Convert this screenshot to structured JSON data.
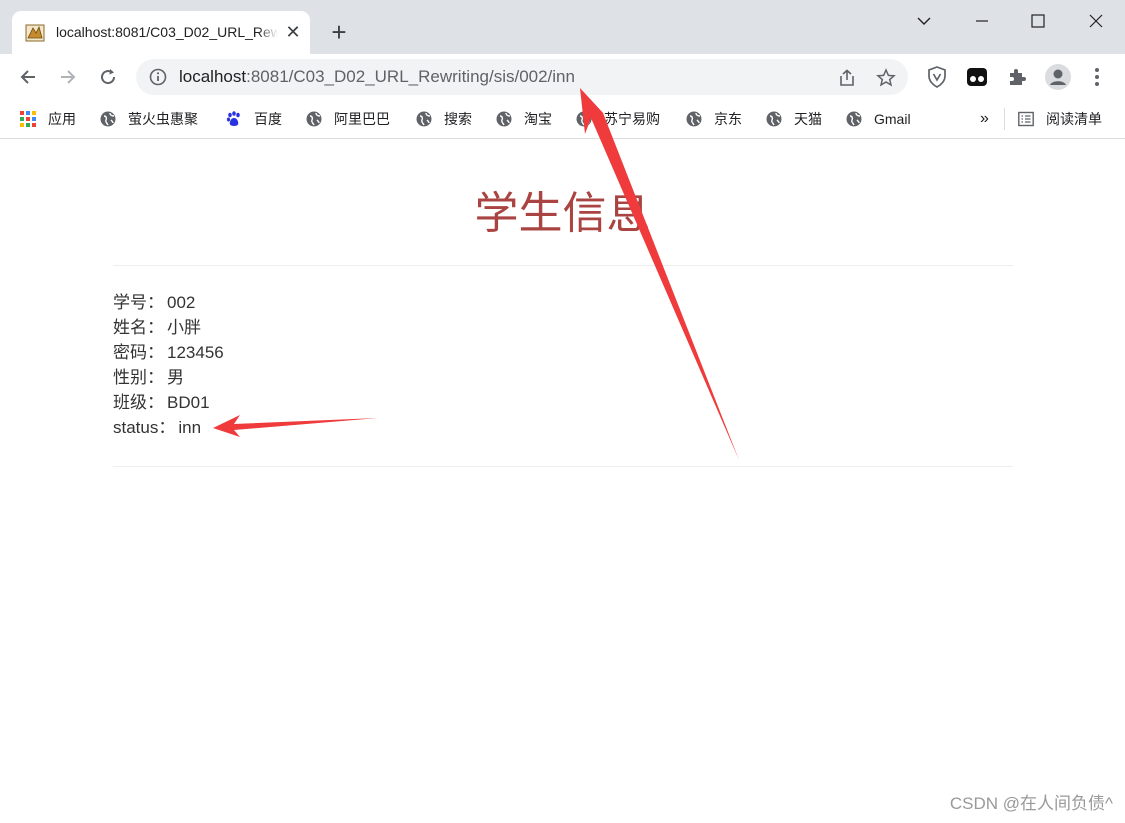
{
  "browser": {
    "tab_title": "localhost:8081/C03_D02_URL_Rewriting/sis/002/inn",
    "new_tab": "+",
    "close_tab": "✕",
    "url_host": "localhost",
    "url_path": ":8081/C03_D02_URL_Rewriting/sis/002/inn"
  },
  "bookmarks": {
    "items": [
      "应用",
      "萤火虫惠聚",
      "百度",
      "阿里巴巴",
      "搜索",
      "淘宝",
      "苏宁易购",
      "京东",
      "天猫",
      "Gmail"
    ],
    "more": "»",
    "reading_list": "阅读清单"
  },
  "page": {
    "title": "学生信息",
    "rows": [
      {
        "label": "学号：",
        "value": "002"
      },
      {
        "label": "姓名：",
        "value": "小胖"
      },
      {
        "label": "密码：",
        "value": "123456"
      },
      {
        "label": "性别：",
        "value": "男"
      },
      {
        "label": "班级：",
        "value": "BD01"
      },
      {
        "label": "status：",
        "value": "inn"
      }
    ]
  },
  "watermark": "CSDN @在人间负债^",
  "colors": {
    "heading": "#a94442",
    "annotation_arrow": "#ef3b3b",
    "text": "#333333"
  }
}
